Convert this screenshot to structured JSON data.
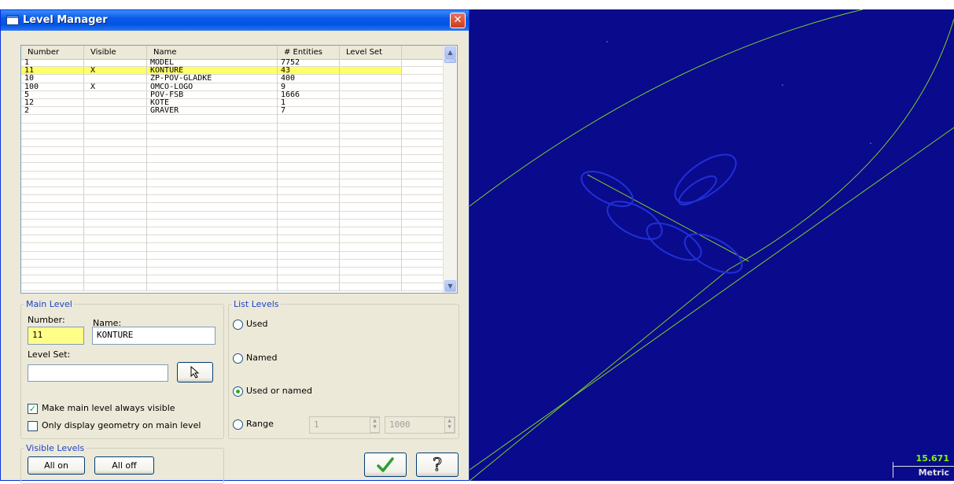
{
  "window": {
    "title": "Level Manager",
    "close_label": "✕"
  },
  "grid": {
    "columns": [
      "Number",
      "Visible",
      "Name",
      "# Entities",
      "Level Set"
    ],
    "rows": [
      {
        "number": "1",
        "visible": "",
        "name": "MODEL",
        "entities": "7752",
        "level_set": ""
      },
      {
        "number": "11",
        "visible": "X",
        "name": "KONTURE",
        "entities": "43",
        "level_set": ""
      },
      {
        "number": "10",
        "visible": "",
        "name": "ZP-POV-GLADKE",
        "entities": "400",
        "level_set": ""
      },
      {
        "number": "100",
        "visible": "X",
        "name": "OMCO-LOGO",
        "entities": "9",
        "level_set": ""
      },
      {
        "number": "5",
        "visible": "",
        "name": "POV-FSB",
        "entities": "1666",
        "level_set": ""
      },
      {
        "number": "12",
        "visible": "",
        "name": "KOTE",
        "entities": "1",
        "level_set": ""
      },
      {
        "number": "2",
        "visible": "",
        "name": "GRAVER",
        "entities": "7",
        "level_set": ""
      }
    ],
    "selected_row": 1
  },
  "main_level": {
    "legend": "Main Level",
    "number_label": "Number:",
    "name_label": "Name:",
    "number_value": "11",
    "name_value": "KONTURE",
    "level_set_label": "Level Set:",
    "level_set_value": "",
    "always_visible_label": "Make main level always visible",
    "always_visible_checked": true,
    "only_display_label": "Only display geometry on main level",
    "only_display_checked": false
  },
  "list_levels": {
    "legend": "List Levels",
    "options": [
      "Used",
      "Named",
      "Used or named",
      "Range"
    ],
    "selected": "Used or named",
    "range_from": "1",
    "range_to": "1000"
  },
  "visible_levels": {
    "legend": "Visible Levels",
    "all_on": "All on",
    "all_off": "All off"
  },
  "buttons": {
    "ok_icon": "checkmark-icon",
    "help_icon": "help-icon"
  },
  "viewport": {
    "background": "#0a0a8c",
    "geometry_color": "#7ccd2e",
    "logo_color": "#2030d8",
    "scale_value": "15.671",
    "unit": "Metric"
  }
}
